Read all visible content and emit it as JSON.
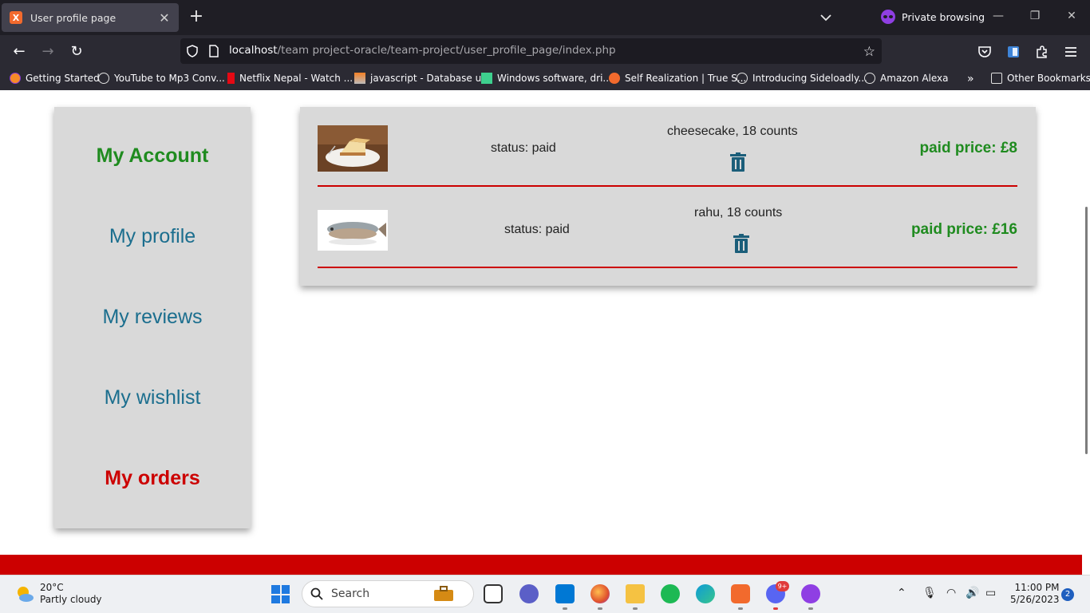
{
  "browser": {
    "tab_title": "User profile page",
    "private_label": "Private browsing",
    "url_host": "localhost",
    "url_path": "/team project-oracle/team-project/user_profile_page/index.php",
    "bookmarks": [
      {
        "label": "Getting Started",
        "icon": "firefox-icon"
      },
      {
        "label": "YouTube to Mp3 Conv...",
        "icon": "globe-icon"
      },
      {
        "label": "Netflix Nepal - Watch ...",
        "icon": "netflix-icon"
      },
      {
        "label": "javascript - Database u...",
        "icon": "stackoverflow-icon"
      },
      {
        "label": "Windows software, dri...",
        "icon": "softpedia-icon"
      },
      {
        "label": "Self Realization | True S...",
        "icon": "flame-icon"
      },
      {
        "label": "Introducing Sideloadly...",
        "icon": "globe-icon"
      },
      {
        "label": "Amazon Alexa",
        "icon": "globe-icon"
      }
    ],
    "other_bookmarks": "Other Bookmarks"
  },
  "sidebar": {
    "title": "My Account",
    "items": [
      {
        "label": "My profile"
      },
      {
        "label": "My reviews"
      },
      {
        "label": "My wishlist"
      },
      {
        "label": "My orders"
      }
    ]
  },
  "orders": [
    {
      "product": "cheesecake, 18 counts",
      "status": "status: paid",
      "price": "paid price: £8",
      "image": "cheesecake-image"
    },
    {
      "product": "rahu, 18 counts",
      "status": "status: paid",
      "price": "paid price: £16",
      "image": "fish-image"
    }
  ],
  "colors": {
    "accent_red": "#cc0000",
    "account_green": "#1f8b1f",
    "link_blue": "#1b6e8e",
    "trash_icon": "#1b5e7a"
  },
  "taskbar": {
    "temperature": "20°C",
    "weather": "Partly cloudy",
    "search_placeholder": "Search",
    "time": "11:00 PM",
    "date": "5/26/2023",
    "notifications": "2",
    "discord_badge": "9+"
  }
}
